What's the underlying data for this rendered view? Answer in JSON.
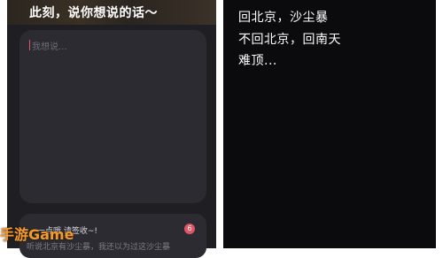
{
  "compose": {
    "title": "此刻，说你想说的话～",
    "placeholder": "我想说..."
  },
  "notice": {
    "text": "一点哦 请签收~!",
    "badge_count": "6",
    "subtext": "听说北京有沙尘暴，我还以为过这沙尘暴"
  },
  "watermark": "手游Game",
  "message": {
    "lines": [
      "回北京，沙尘暴",
      "不回北京，回南天",
      "难顶..."
    ]
  }
}
